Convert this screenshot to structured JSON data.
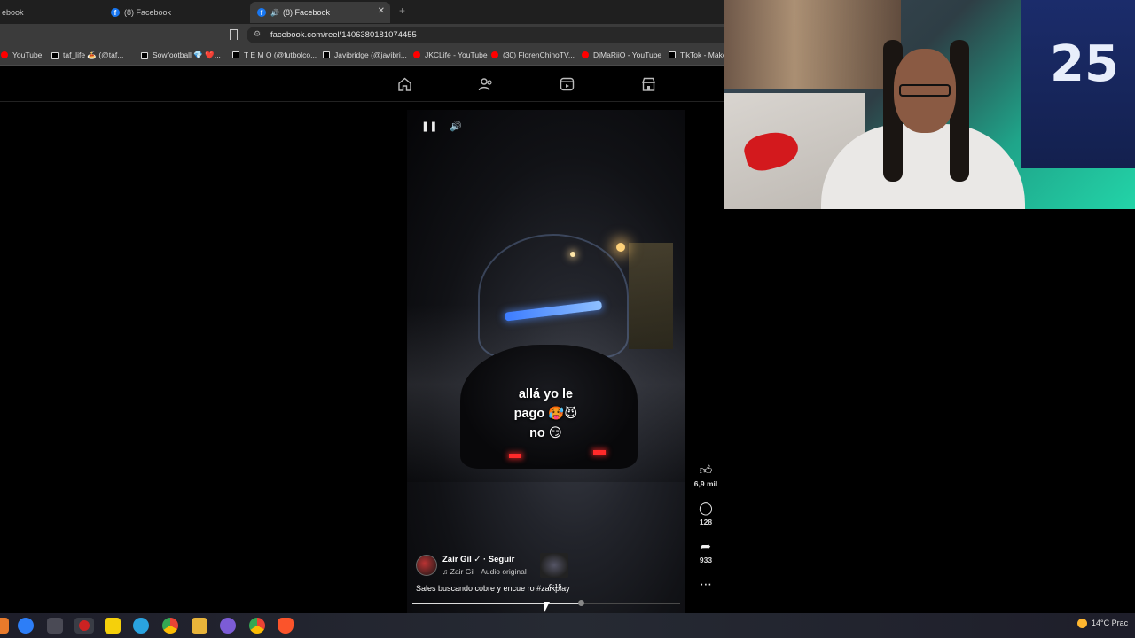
{
  "tabs": [
    {
      "label": "ebook"
    },
    {
      "label": "(8) Facebook"
    },
    {
      "label": "(8) Facebook"
    }
  ],
  "address_bar": {
    "url": "facebook.com/reel/1406380181074455"
  },
  "bookmarks": [
    {
      "label": "YouTube",
      "icon": "youtube-icon"
    },
    {
      "label": "taf_life 🍝 (@taf...",
      "icon": "tiktok-icon"
    },
    {
      "label": "Sowfootball 💎 ❤️...",
      "icon": "tiktok-icon"
    },
    {
      "label": "T E M O (@futbolco...",
      "icon": "tiktok-icon"
    },
    {
      "label": "Javibridge (@javibri...",
      "icon": "tiktok-icon"
    },
    {
      "label": "JKCLife - YouTube",
      "icon": "youtube-icon"
    },
    {
      "label": "(30) FlorenChinoTV...",
      "icon": "youtube-icon"
    },
    {
      "label": "DjMaRiiO - YouTube",
      "icon": "youtube-icon"
    },
    {
      "label": "TikTok - Make",
      "icon": "tiktok-icon"
    }
  ],
  "facebook_nav": [
    "home-icon",
    "friends-icon",
    "video-icon",
    "marketplace-icon"
  ],
  "reel": {
    "caption_lines": [
      "allá yo le",
      "pago 🥵😈",
      "no 😏"
    ],
    "author": "Zair Gil",
    "follow_label": "Seguir",
    "audio": "Zair Gil · Audio original",
    "description": "Sales buscando cobre y encue         ro #zaikplay",
    "hover_time": "0:15",
    "likes": "6,9 mil",
    "comments": "128",
    "shares": "933",
    "progress_fraction": 0.63
  },
  "webcam": {
    "jersey_number": "25"
  },
  "taskbar": {
    "weather": "14°C  Prac"
  },
  "colors": {
    "facebook_blue": "#1877f2",
    "youtube_red": "#ff0000",
    "page_bg": "#000000"
  }
}
